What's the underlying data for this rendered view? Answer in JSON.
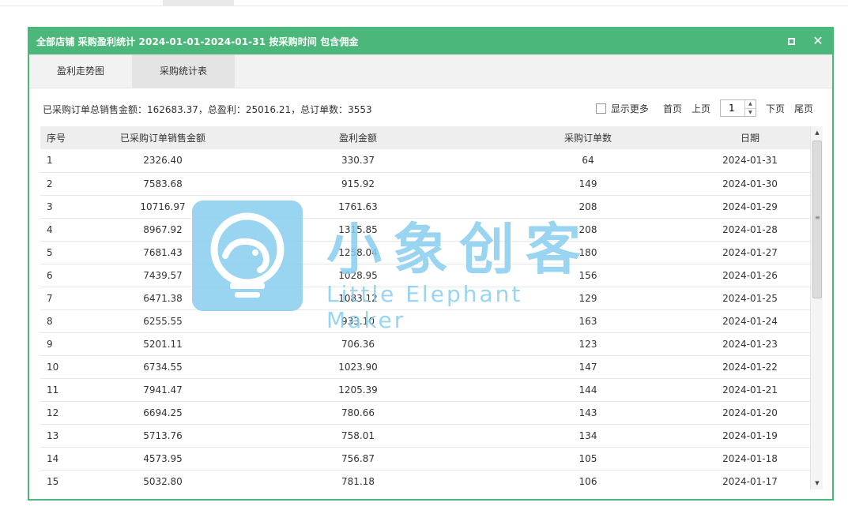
{
  "dialog": {
    "title": "全部店铺 采购盈利统计 2024-01-01-2024-01-31 按采购时间 包含佣金",
    "maximize_icon": "maximize-icon",
    "close_icon": "close-icon",
    "close_glyph": "✕",
    "accent_color": "#4cb77a"
  },
  "tabs": [
    {
      "label": "盈利走势图",
      "active": false
    },
    {
      "label": "采购统计表",
      "active": true
    }
  ],
  "summary": {
    "text": "已采购订单总销售金额：162683.37，总盈利：25016.21，总订单数：3553"
  },
  "pager": {
    "show_more_label": "显示更多",
    "show_more_checked": false,
    "first_label": "首页",
    "prev_label": "上页",
    "page_value": "1",
    "next_label": "下页",
    "last_label": "尾页",
    "spin_up": "▲",
    "spin_down": "▼"
  },
  "table": {
    "headers": [
      "序号",
      "已采购订单销售金额",
      "盈利金额",
      "采购订单数",
      "日期"
    ],
    "rows": [
      [
        "1",
        "2326.40",
        "330.37",
        "64",
        "2024-01-31"
      ],
      [
        "2",
        "7583.68",
        "915.92",
        "149",
        "2024-01-30"
      ],
      [
        "3",
        "10716.97",
        "1761.63",
        "208",
        "2024-01-29"
      ],
      [
        "4",
        "8967.92",
        "1315.85",
        "208",
        "2024-01-28"
      ],
      [
        "5",
        "7681.43",
        "1258.04",
        "180",
        "2024-01-27"
      ],
      [
        "6",
        "7439.57",
        "1028.95",
        "156",
        "2024-01-26"
      ],
      [
        "7",
        "6471.38",
        "1083.12",
        "129",
        "2024-01-25"
      ],
      [
        "8",
        "6255.55",
        "933.10",
        "163",
        "2024-01-24"
      ],
      [
        "9",
        "5201.11",
        "706.36",
        "123",
        "2024-01-23"
      ],
      [
        "10",
        "6734.55",
        "1023.90",
        "147",
        "2024-01-22"
      ],
      [
        "11",
        "7941.47",
        "1205.39",
        "144",
        "2024-01-21"
      ],
      [
        "12",
        "6694.25",
        "780.66",
        "143",
        "2024-01-20"
      ],
      [
        "13",
        "5713.76",
        "758.01",
        "134",
        "2024-01-19"
      ],
      [
        "14",
        "4573.95",
        "756.87",
        "105",
        "2024-01-18"
      ],
      [
        "15",
        "5032.80",
        "781.18",
        "106",
        "2024-01-17"
      ]
    ]
  },
  "scrollbar": {
    "up_glyph": "▲",
    "down_glyph": "▼",
    "grip_glyph": "≡"
  },
  "watermark": {
    "title": "小象创客",
    "subtitle": "Little Elephant Maker",
    "icon": "elephant-logo-icon",
    "color": "#88cdee"
  }
}
